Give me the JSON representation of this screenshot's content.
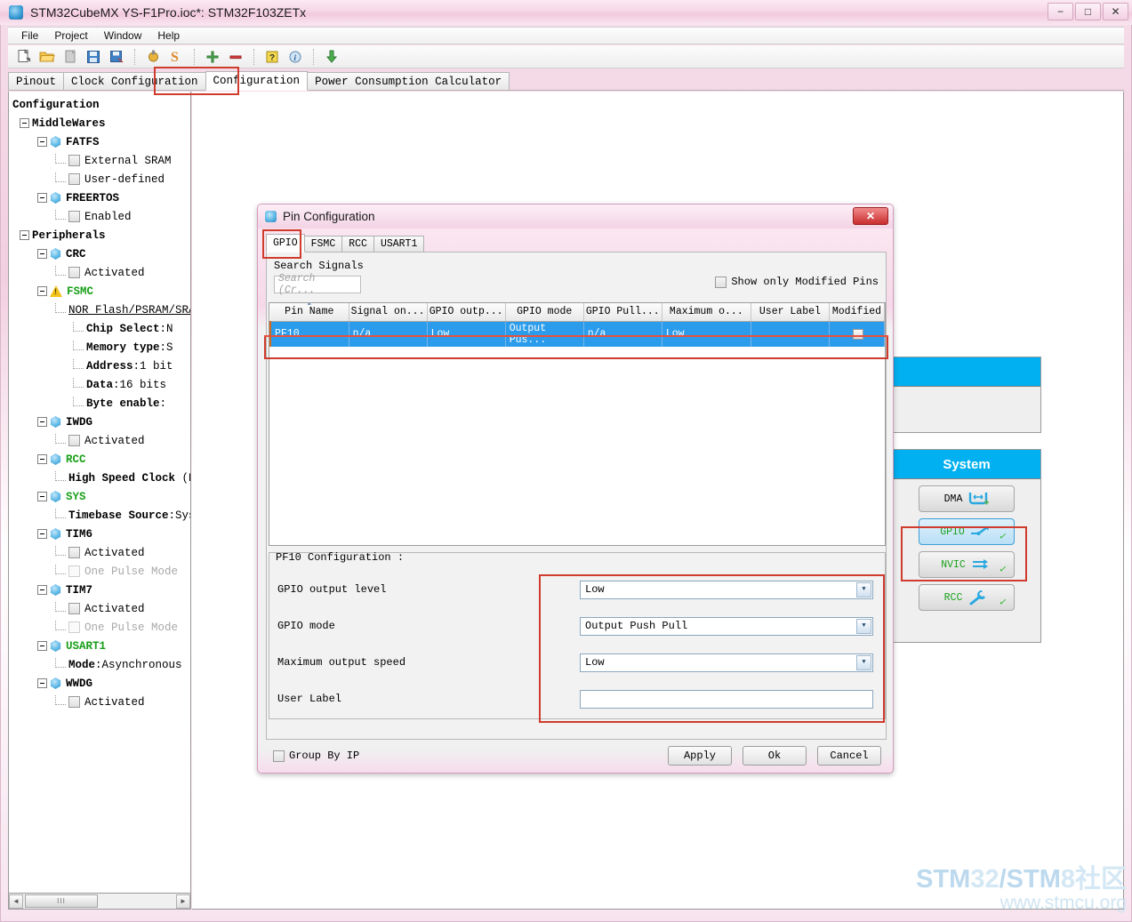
{
  "window": {
    "title": "STM32CubeMX YS-F1Pro.ioc*: STM32F103ZETx",
    "minimize_label": "−",
    "maximize_label": "□",
    "close_label": "✕"
  },
  "menu": {
    "items": [
      "File",
      "Project",
      "Window",
      "Help"
    ]
  },
  "toolbar": {
    "icons": [
      "new-project-icon",
      "open-project-icon",
      "close-project-icon",
      "save-icon",
      "save-as-icon",
      "generate-report-icon",
      "generate-code-icon",
      "zoom-in-icon",
      "zoom-out-icon",
      "help-icon",
      "about-icon",
      "update-icon"
    ]
  },
  "tabs": {
    "items": [
      {
        "label": "Pinout",
        "active": false
      },
      {
        "label": "Clock Configuration",
        "active": false
      },
      {
        "label": "Configuration",
        "active": true
      },
      {
        "label": "Power Consumption Calculator",
        "active": false
      }
    ]
  },
  "sidebar": {
    "root": "Configuration",
    "nodes": [
      {
        "indent": 0,
        "type": "group",
        "label": "MiddleWares",
        "style": "bold"
      },
      {
        "indent": 1,
        "type": "periph",
        "label": "FATFS",
        "style": "bold"
      },
      {
        "indent": 2,
        "type": "checkbox",
        "label": "External SRAM",
        "checked": false
      },
      {
        "indent": 2,
        "type": "checkbox",
        "label": "User-defined",
        "checked": false
      },
      {
        "indent": 1,
        "type": "periph",
        "label": "FREERTOS",
        "style": "bold"
      },
      {
        "indent": 2,
        "type": "checkbox",
        "label": "Enabled",
        "checked": false
      },
      {
        "indent": 0,
        "type": "group",
        "label": "Peripherals",
        "style": "bold"
      },
      {
        "indent": 1,
        "type": "periph",
        "label": "CRC",
        "style": "bold"
      },
      {
        "indent": 2,
        "type": "checkbox",
        "label": "Activated",
        "checked": false
      },
      {
        "indent": 1,
        "type": "warn",
        "label": "FSMC",
        "style": "green"
      },
      {
        "indent": 2,
        "type": "link",
        "label": "NOR Flash/PSRAM/SRAM/RO"
      },
      {
        "indent": 3,
        "type": "kv",
        "key": "Chip Select",
        "value": ":N"
      },
      {
        "indent": 3,
        "type": "kv",
        "key": "Memory type",
        "value": ":S"
      },
      {
        "indent": 3,
        "type": "kv",
        "key": "Address",
        "value": ":1 bit"
      },
      {
        "indent": 3,
        "type": "kv",
        "key": "Data",
        "value": ":16 bits"
      },
      {
        "indent": 3,
        "type": "kv",
        "key": "Byte enable",
        "value": ":"
      },
      {
        "indent": 1,
        "type": "periph",
        "label": "IWDG",
        "style": "bold"
      },
      {
        "indent": 2,
        "type": "checkbox",
        "label": "Activated",
        "checked": false
      },
      {
        "indent": 1,
        "type": "periph",
        "label": "RCC",
        "style": "green"
      },
      {
        "indent": 2,
        "type": "kv",
        "key": "High Speed Clock",
        "value": " (HS"
      },
      {
        "indent": 1,
        "type": "periph",
        "label": "SYS",
        "style": "green"
      },
      {
        "indent": 2,
        "type": "kv",
        "key": "Timebase Source",
        "value": ":SysI"
      },
      {
        "indent": 1,
        "type": "periph",
        "label": "TIM6",
        "style": "bold"
      },
      {
        "indent": 2,
        "type": "checkbox",
        "label": "Activated",
        "checked": false
      },
      {
        "indent": 2,
        "type": "checkbox",
        "label": "One Pulse Mode",
        "checked": false,
        "style": "gray"
      },
      {
        "indent": 1,
        "type": "periph",
        "label": "TIM7",
        "style": "bold"
      },
      {
        "indent": 2,
        "type": "checkbox",
        "label": "Activated",
        "checked": false
      },
      {
        "indent": 2,
        "type": "checkbox",
        "label": "One Pulse Mode",
        "checked": false,
        "style": "gray"
      },
      {
        "indent": 1,
        "type": "periph",
        "label": "USART1",
        "style": "green"
      },
      {
        "indent": 2,
        "type": "kv",
        "key": "Mode",
        "value": ":Asynchronous"
      },
      {
        "indent": 1,
        "type": "periph",
        "label": "WWDG",
        "style": "bold"
      },
      {
        "indent": 2,
        "type": "checkbox",
        "label": "Activated",
        "checked": false
      }
    ],
    "scrollbar": {
      "left_arrow": "◄",
      "right_arrow": "►",
      "grip": "III"
    }
  },
  "right_panels": [
    {
      "name": "unnamed-panel",
      "header": "",
      "buttons": []
    },
    {
      "name": "system-panel",
      "header": "System",
      "buttons": [
        {
          "label": "DMA",
          "icon": "dma-icon",
          "selected": false,
          "configured": false,
          "green": false
        },
        {
          "label": "GPIO",
          "icon": "gpio-icon",
          "selected": true,
          "configured": true,
          "green": true
        },
        {
          "label": "NVIC",
          "icon": "nvic-icon",
          "selected": false,
          "configured": true,
          "green": true
        },
        {
          "label": "RCC",
          "icon": "rcc-icon",
          "selected": false,
          "configured": true,
          "green": true
        }
      ]
    }
  ],
  "dialog": {
    "title": "Pin Configuration",
    "close_label": "✕",
    "tabs": [
      {
        "label": "GPIO",
        "active": true
      },
      {
        "label": "FSMC",
        "active": false
      },
      {
        "label": "RCC",
        "active": false
      },
      {
        "label": "USART1",
        "active": false
      }
    ],
    "search": {
      "label": "Search Signals",
      "placeholder": "Search (Cr...",
      "value": ""
    },
    "show_modified": {
      "label": "Show only Modified Pins",
      "checked": false
    },
    "table": {
      "columns": [
        "Pin Name",
        "Signal on...",
        "GPIO outp...",
        "GPIO mode",
        "GPIO Pull...",
        "Maximum o...",
        "User Label",
        "Modified"
      ],
      "sorted_column": "Pin Name",
      "rows": [
        {
          "selected": true,
          "cells": [
            "PF10",
            "n/a",
            "Low",
            "Output Pus...",
            "n/a",
            "Low",
            ""
          ],
          "modified": false
        }
      ]
    },
    "config": {
      "title": "PF10 Configuration :",
      "fields": [
        {
          "label": "GPIO output level",
          "type": "combo",
          "value": "Low"
        },
        {
          "label": "GPIO mode",
          "type": "combo",
          "value": "Output Push Pull"
        },
        {
          "label": "Maximum output speed",
          "type": "combo",
          "value": "Low"
        },
        {
          "label": "User Label",
          "type": "text",
          "value": ""
        }
      ],
      "combo_arrow": "▼"
    },
    "footer": {
      "group_by_ip": {
        "label": "Group By IP",
        "checked": false
      },
      "buttons": [
        "Apply",
        "Ok",
        "Cancel"
      ]
    }
  },
  "watermark": {
    "line1_a": "STM",
    "line1_b": "32",
    "line1_c": "/STM",
    "line1_d": "8社区",
    "line2": "www.stmcu.org"
  },
  "colors": {
    "accent_blue": "#00b0f0",
    "selection_blue": "#2b9ceb",
    "annotation_red": "#cf3b2c",
    "green_text": "#1aa01a",
    "titlebar_pink": "#f2c9dd"
  }
}
